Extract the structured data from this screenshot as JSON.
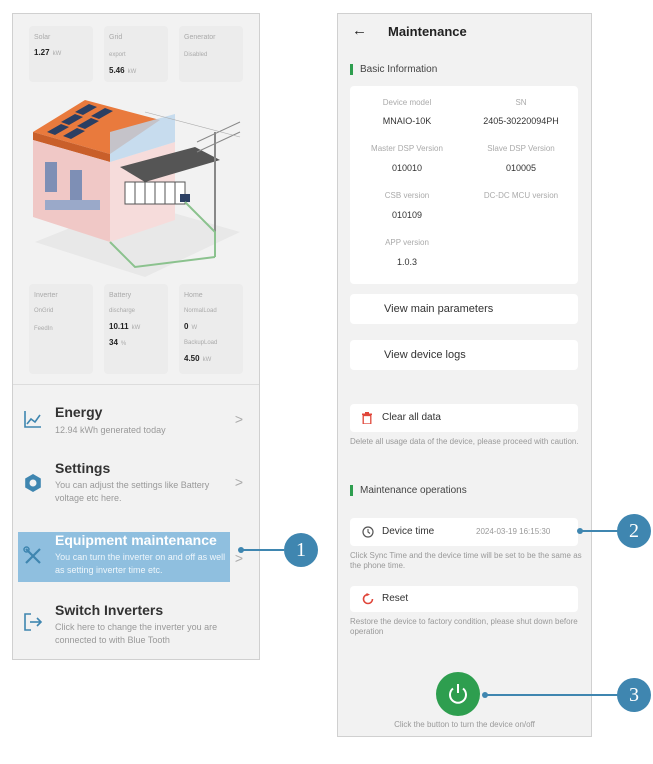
{
  "left_screen": {
    "top_cards": [
      {
        "label": "Solar",
        "value": "1.27",
        "unit": "kW"
      },
      {
        "label": "Grid",
        "sub": "export",
        "value": "5.46",
        "unit": "kW"
      },
      {
        "label": "Generator",
        "sub": "Disabled"
      }
    ],
    "bottom_cards": {
      "inverter": {
        "label": "Inverter",
        "status1": "OnGrid",
        "status2": "FeedIn"
      },
      "battery": {
        "label": "Battery",
        "sub": "discharge",
        "value": "10.11",
        "unit": "kW",
        "soc": "34",
        "soc_unit": "%"
      },
      "home": {
        "label": "Home",
        "sub1": "NormalLoad",
        "value1": "0",
        "unit1": "W",
        "sub2": "BackupLoad",
        "value2": "4.50",
        "unit2": "kW"
      }
    },
    "menu": [
      {
        "title": "Energy",
        "desc": "12.94 kWh generated today",
        "icon": "chart-icon"
      },
      {
        "title": "Settings",
        "desc": "You can adjust the settings like Battery voltage etc here.",
        "icon": "gear-icon"
      },
      {
        "title": "Equipment maintenance",
        "desc": "You can turn the inverter on and off as well as setting inverter time etc.",
        "icon": "tools-icon"
      },
      {
        "title": "Switch Inverters",
        "desc": "Click here to change the inverter you are connected to with Blue Tooth",
        "icon": "switch-icon"
      }
    ],
    "chevron": ">"
  },
  "right_screen": {
    "back": "←",
    "title": "Maintenance",
    "basic_info_title": "Basic Information",
    "info": {
      "device_model_label": "Device model",
      "device_model": "MNAIO-10K",
      "sn_label": "SN",
      "sn": "2405-30220094PH",
      "master_dsp_label": "Master DSP Version",
      "master_dsp": "010010",
      "slave_dsp_label": "Slave DSP Version",
      "slave_dsp": "010005",
      "csb_label": "CSB version",
      "csb": "010109",
      "dcdc_label": "DC-DC MCU version",
      "app_label": "APP version",
      "app": "1.0.3"
    },
    "view_params": "View main parameters",
    "view_logs": "View device logs",
    "clear_data": "Clear all data",
    "clear_note": "Delete all usage data of the device, please proceed with caution.",
    "ops_title": "Maintenance operations",
    "device_time_label": "Device time",
    "device_time_value": "2024-03-19 16:15:30",
    "sync_note": "Click Sync Time and the device time will be set to be the same as the phone time.",
    "reset": "Reset",
    "reset_note": "Restore the device to factory condition, please shut down before operation",
    "power_note": "Click the button to turn the device on/off"
  },
  "callouts": [
    "1",
    "2",
    "3"
  ],
  "colors": {
    "accent_green": "#2e9e4f",
    "callout_blue": "#3f86b0",
    "highlight": "#8fbfdf",
    "danger_red": "#e0463a"
  }
}
